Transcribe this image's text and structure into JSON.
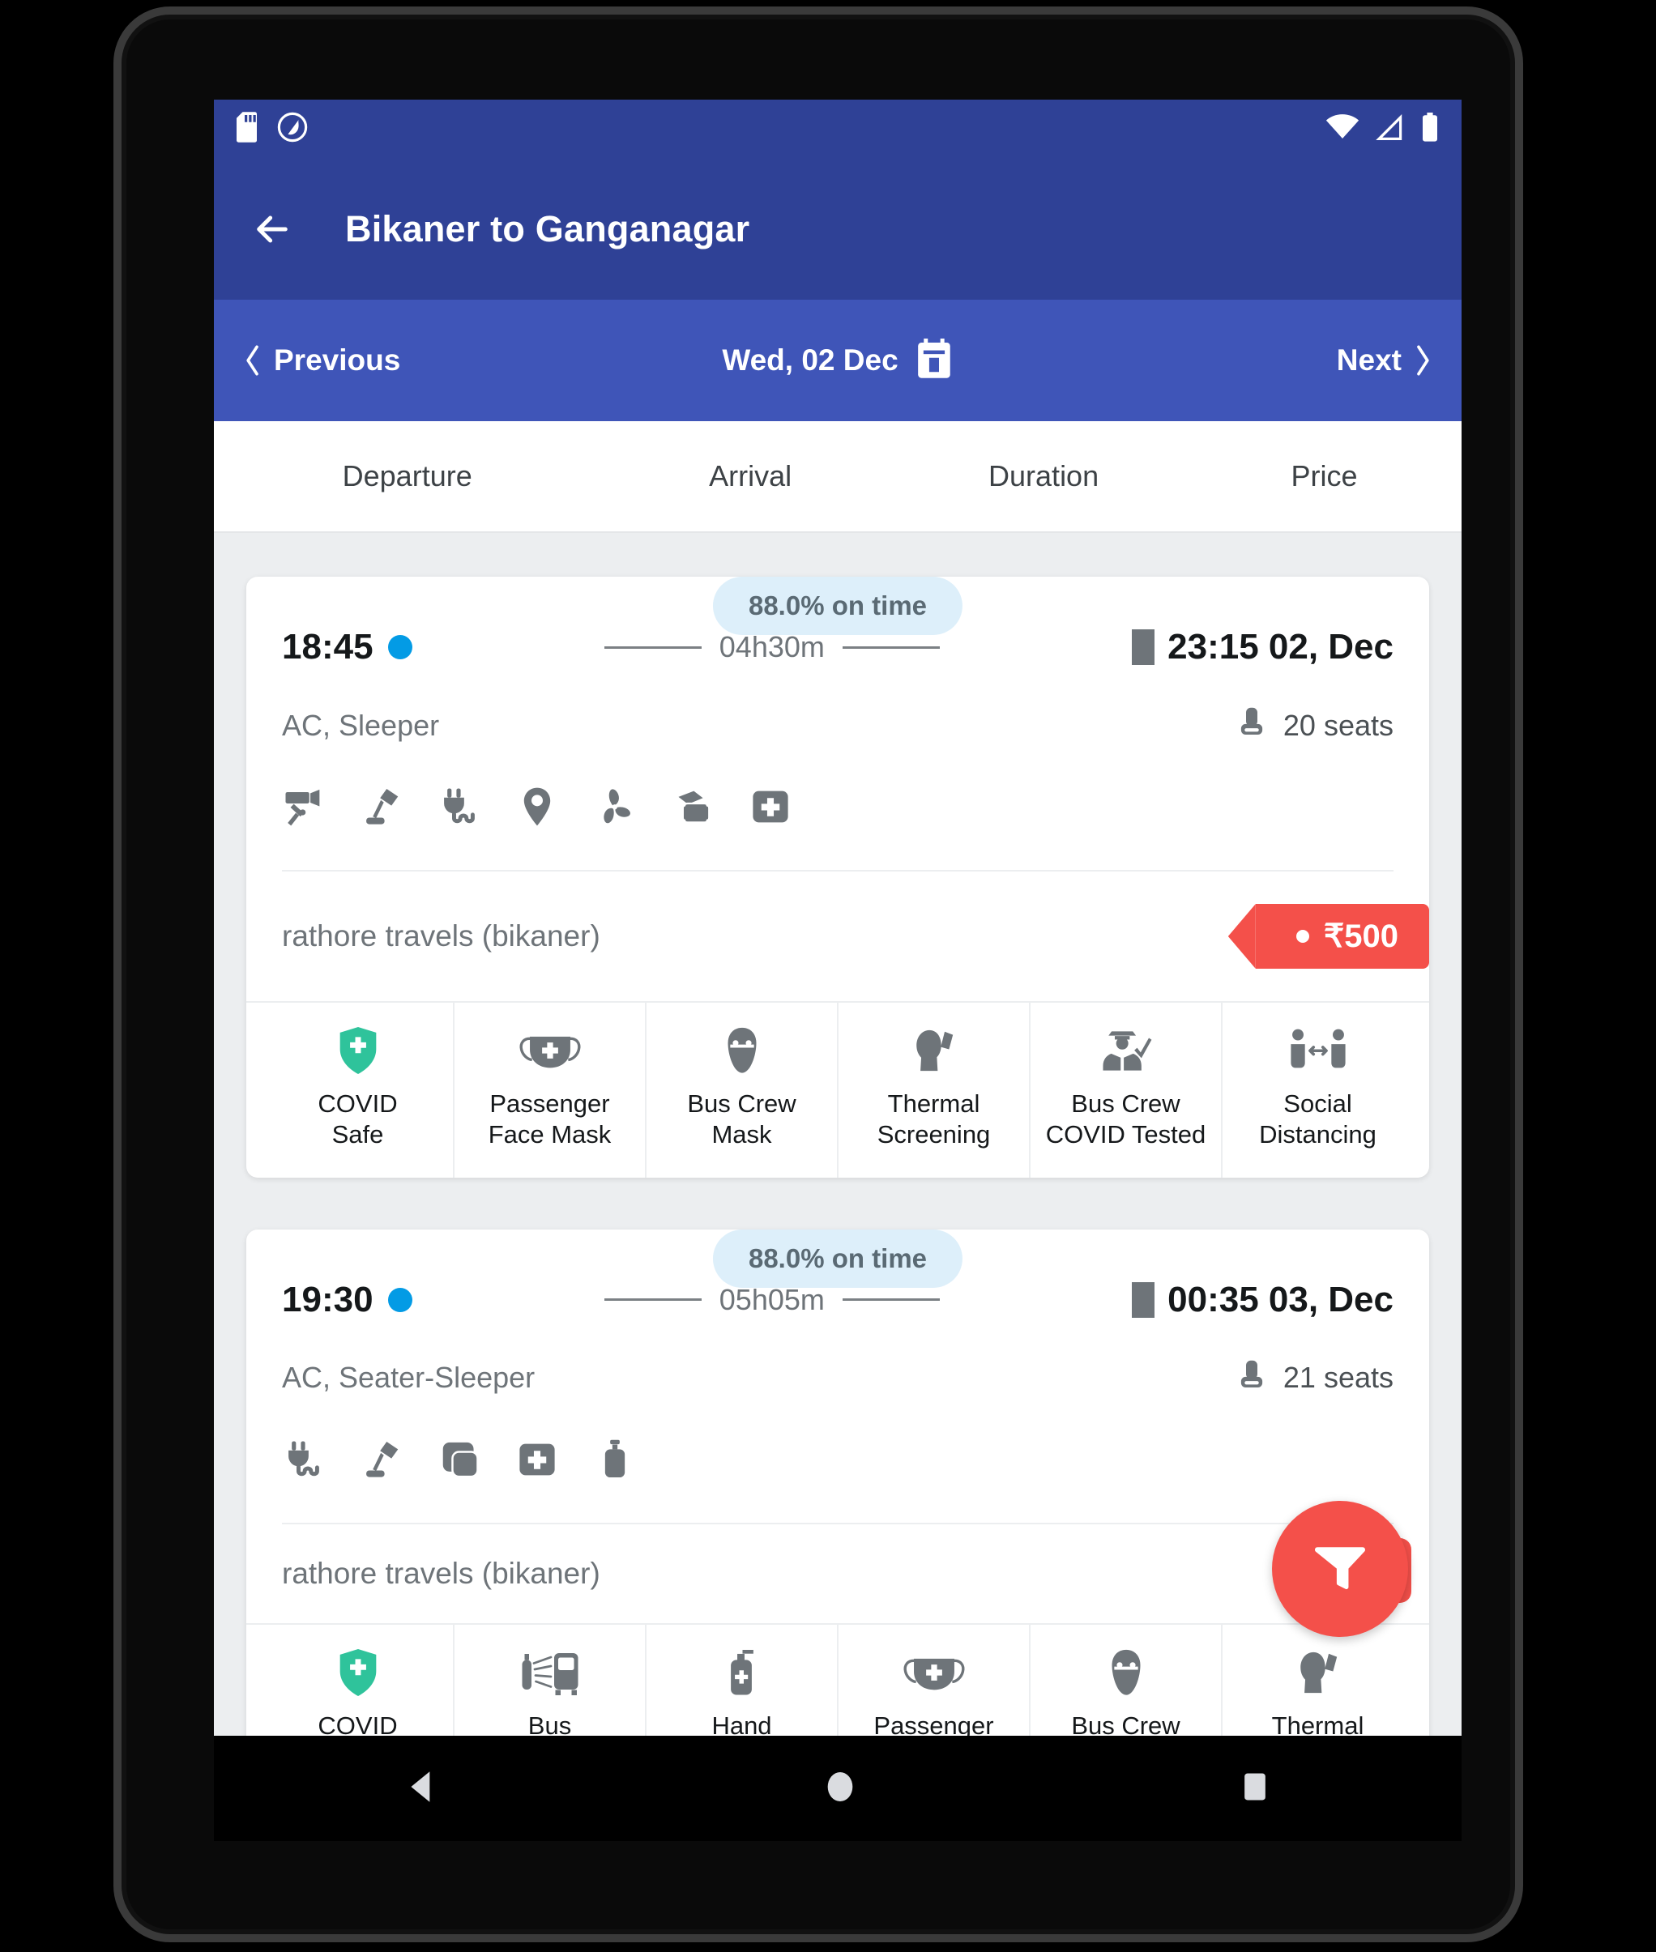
{
  "status_bar": {
    "left_icons": [
      "sd-card-icon",
      "adaptive-brightness-icon"
    ],
    "right_icons": [
      "wifi-icon",
      "cellular-signal-icon",
      "battery-icon"
    ]
  },
  "app_bar": {
    "back_icon": "back-arrow-icon",
    "title": "Bikaner to Ganganagar"
  },
  "date_nav": {
    "previous_label": "Previous",
    "date_label": "Wed, 02 Dec",
    "calendar_icon": "calendar-icon",
    "next_label": "Next"
  },
  "columns": [
    {
      "label": "Departure"
    },
    {
      "label": "Arrival"
    },
    {
      "label": "Duration"
    },
    {
      "label": "Price"
    }
  ],
  "buses": [
    {
      "on_time": "88.0% on time",
      "departure": "18:45",
      "duration": "04h30m",
      "arrival": "23:15 02, Dec",
      "bus_type": "AC, Sleeper",
      "seats": "20 seats",
      "amenities": [
        "cctv-camera-icon",
        "reading-lamp-icon",
        "charging-point-icon",
        "gps-tracking-icon",
        "fan-icon",
        "pillow-blanket-icon",
        "first-aid-kit-icon"
      ],
      "operator": "rathore travels (bikaner)",
      "price": "₹500",
      "covid_features": [
        {
          "icon": "covid-shield-icon",
          "label": "COVID\nSafe"
        },
        {
          "icon": "face-mask-icon",
          "label": "Passenger\nFace Mask"
        },
        {
          "icon": "crew-mask-icon",
          "label": "Bus Crew\nMask"
        },
        {
          "icon": "thermal-screening-icon",
          "label": "Thermal\nScreening"
        },
        {
          "icon": "crew-tested-icon",
          "label": "Bus Crew\nCOVID Tested"
        },
        {
          "icon": "social-distancing-icon",
          "label": "Social\nDistancing"
        }
      ]
    },
    {
      "on_time": "88.0% on time",
      "departure": "19:30",
      "duration": "05h05m",
      "arrival": "00:35 03, Dec",
      "bus_type": "AC, Seater-Sleeper",
      "seats": "21 seats",
      "amenities": [
        "charging-point-icon",
        "reading-lamp-icon",
        "blanket-icon",
        "first-aid-kit-icon",
        "water-bottle-icon"
      ],
      "operator": "rathore travels (bikaner)",
      "price": "",
      "covid_features": [
        {
          "icon": "covid-shield-icon",
          "label": "COVID"
        },
        {
          "icon": "bus-sanitized-icon",
          "label": "Bus"
        },
        {
          "icon": "hand-sanitizer-icon",
          "label": "Hand"
        },
        {
          "icon": "face-mask-icon",
          "label": "Passenger"
        },
        {
          "icon": "crew-mask-icon",
          "label": "Bus Crew"
        },
        {
          "icon": "thermal-screening-icon",
          "label": "Thermal"
        }
      ]
    }
  ],
  "filter": {
    "icon": "funnel-filter-icon"
  },
  "android_nav": {
    "back": "nav-back-icon",
    "home": "nav-home-icon",
    "recents": "nav-recents-icon"
  },
  "colors": {
    "app_bar_blue": "#2f4196",
    "date_nav_blue": "#3f55b8",
    "accent_red": "#f4504a",
    "dot_blue": "#039be5",
    "badge_bg": "#ddeffa",
    "shield_green": "#2fc39b",
    "page_bg": "#eceef0"
  }
}
